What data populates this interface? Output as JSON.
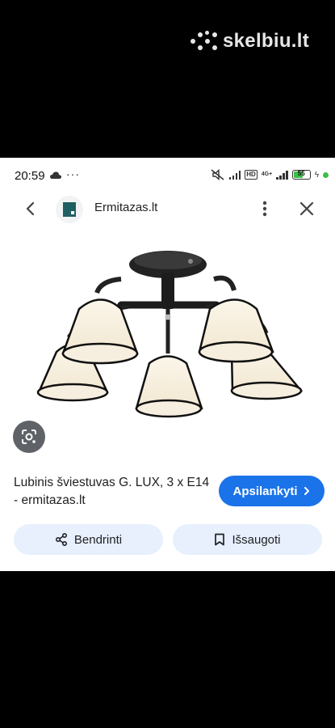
{
  "watermark": {
    "text": "skelbiu.lt"
  },
  "status_bar": {
    "time": "20:59",
    "more": "···",
    "hd_label": "HD",
    "network_label": "4G+",
    "battery_level": "55"
  },
  "header": {
    "site_name": "Ermitazas.lt"
  },
  "result": {
    "title": "Lubinis šviestuvas G. LUX, 3 x E14 - ermitazas.lt",
    "visit_label": "Apsilankyti",
    "share_label": "Bendrinti",
    "save_label": "Išsaugoti"
  },
  "icons": [
    "cloud-icon",
    "mute-icon",
    "signal-icon",
    "battery-icon",
    "back-arrow-icon",
    "kebab-menu-icon",
    "close-icon",
    "lens-icon",
    "chevron-right-icon",
    "share-icon",
    "bookmark-icon"
  ],
  "colors": {
    "accent": "#1a73e8",
    "pill_bg": "#e8f0fe",
    "text": "#202124",
    "battery_green": "#3cbe4a"
  }
}
